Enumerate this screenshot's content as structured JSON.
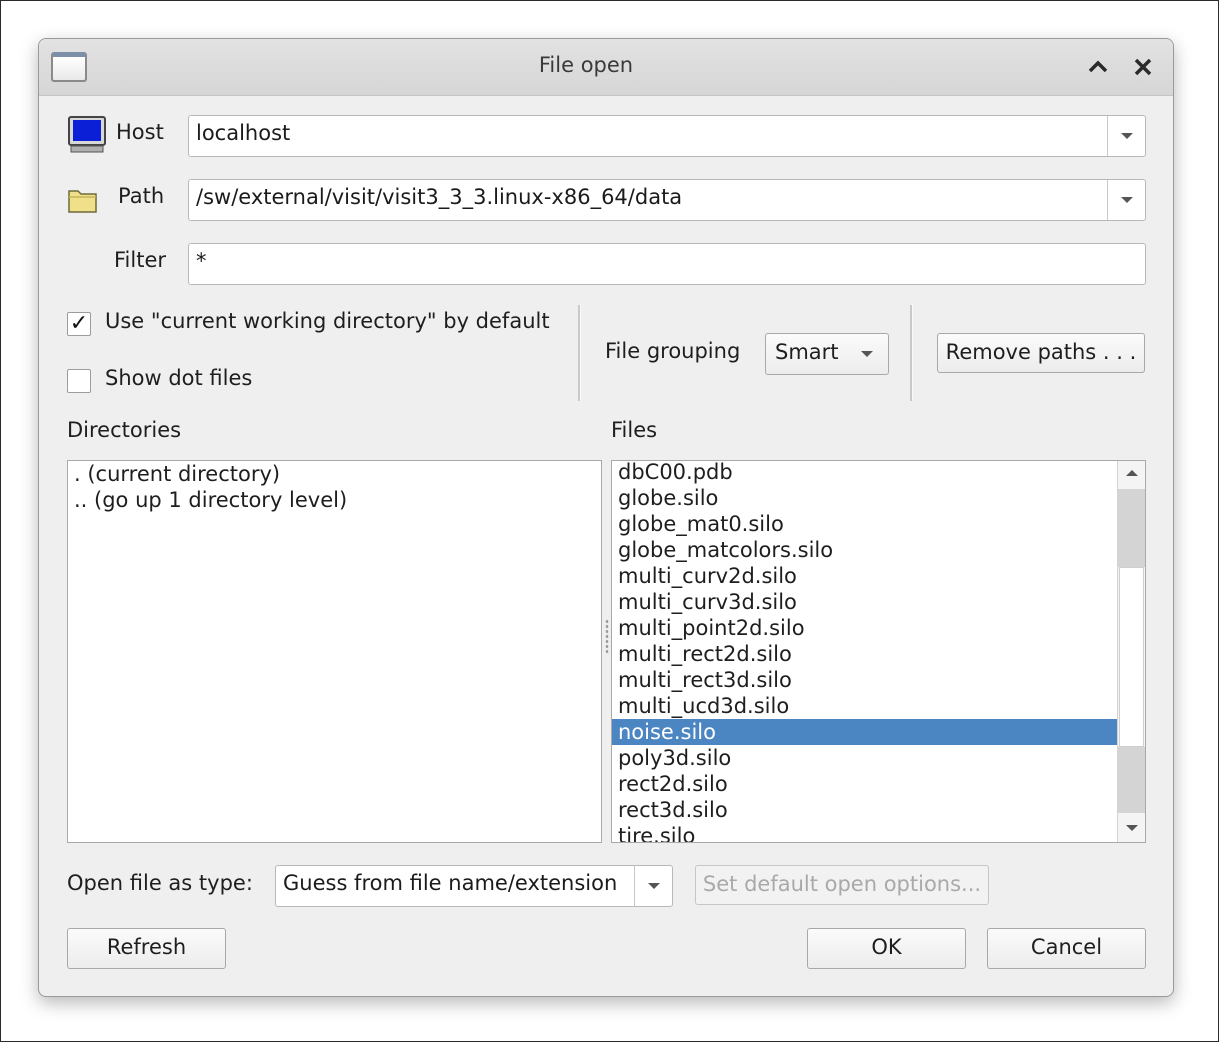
{
  "window": {
    "title": "File open"
  },
  "host": {
    "label": "Host",
    "value": "localhost"
  },
  "path": {
    "label": "Path",
    "value": "/sw/external/visit/visit3_3_3.linux-x86_64/data"
  },
  "filter": {
    "label": "Filter",
    "value": "*"
  },
  "options": {
    "use_cwd": {
      "label": "Use \"current working directory\" by default",
      "checked": true,
      "mark": "✓"
    },
    "show_dot": {
      "label": "Show dot files",
      "checked": false
    }
  },
  "grouping": {
    "label": "File grouping",
    "value": "Smart"
  },
  "remove_paths": {
    "label": "Remove paths . . ."
  },
  "directories": {
    "header": "Directories",
    "items": [
      ". (current directory)",
      ".. (go up 1 directory level)"
    ]
  },
  "files": {
    "header": "Files",
    "items": [
      "dbC00.pdb",
      "globe.silo",
      "globe_mat0.silo",
      "globe_matcolors.silo",
      "multi_curv2d.silo",
      "multi_curv3d.silo",
      "multi_point2d.silo",
      "multi_rect2d.silo",
      "multi_rect3d.silo",
      "multi_ucd3d.silo",
      "noise.silo",
      "poly3d.silo",
      "rect2d.silo",
      "rect3d.silo",
      "tire.silo"
    ],
    "selected": "noise.silo"
  },
  "open_type": {
    "label": "Open file as type:",
    "value": "Guess from file name/extension"
  },
  "default_options": {
    "label": "Set default open options..."
  },
  "buttons": {
    "refresh": "Refresh",
    "ok": "OK",
    "cancel": "Cancel"
  },
  "colors": {
    "selection": "#4b86c2",
    "dialog_bg": "#efefef"
  },
  "icons": {
    "host": "computer-monitor-icon",
    "path": "folder-icon",
    "title": "window-icon"
  }
}
